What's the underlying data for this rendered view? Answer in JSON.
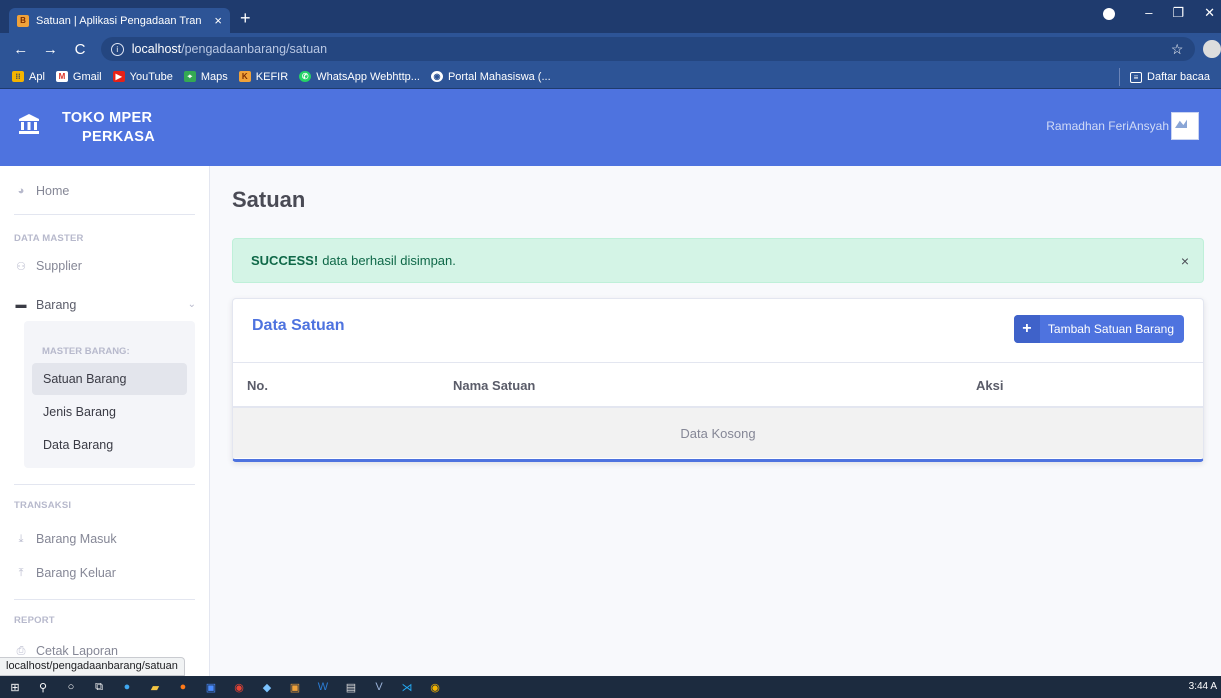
{
  "browser": {
    "tab_title": "Satuan | Aplikasi Pengadaan Tran",
    "tab_close": "×",
    "new_tab": "+",
    "url_host": "localhost",
    "url_path": "/pengadaanbarang/satuan",
    "bookmarks": [
      "Apl",
      "Gmail",
      "YouTube",
      "Maps",
      "KEFIR",
      "WhatsApp Webhttp...",
      "Portal Mahasiswa (..."
    ],
    "reading_list": "Daftar bacaa",
    "status_url": "localhost/pengadaanbarang/satuan"
  },
  "header": {
    "brand_line1": "TOKO MPER",
    "brand_line2": "PERKASA",
    "user_name": "Ramadhan FeriAnsyah"
  },
  "sidebar": {
    "home": "Home",
    "section_master": "DATA MASTER",
    "supplier": "Supplier",
    "barang": "Barang",
    "submenu_head": "MASTER BARANG:",
    "satuan_barang": "Satuan Barang",
    "jenis_barang": "Jenis Barang",
    "data_barang": "Data Barang",
    "section_transaksi": "TRANSAKSI",
    "barang_masuk": "Barang Masuk",
    "barang_keluar": "Barang Keluar",
    "section_report": "REPORT",
    "cetak_laporan": "Cetak Laporan"
  },
  "main": {
    "page_title": "Satuan",
    "alert_strong": "SUCCESS!",
    "alert_text": "data berhasil disimpan.",
    "alert_close": "×",
    "card_title": "Data Satuan",
    "add_button_label": "Tambah Satuan Barang",
    "table_headers": [
      "No.",
      "Nama Satuan",
      "Aksi"
    ],
    "empty_text": "Data Kosong"
  },
  "taskbar": {
    "time": "3:44 A"
  },
  "colors": {
    "primary": "#4e73df",
    "success_bg": "#d4f4e6",
    "success_text": "#0f6848"
  }
}
